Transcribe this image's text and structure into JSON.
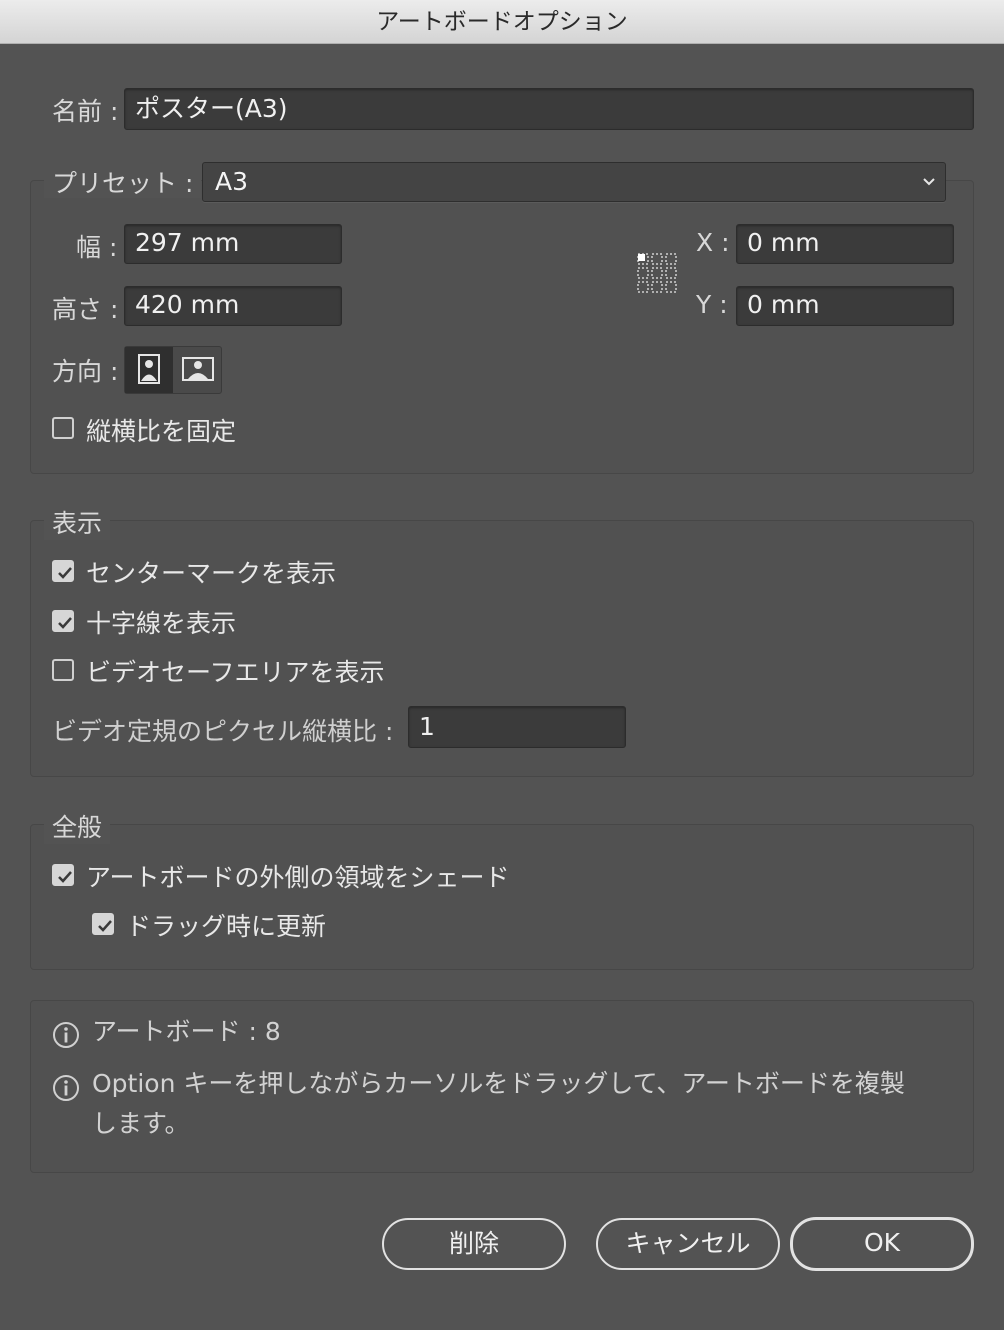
{
  "window": {
    "title": "アートボードオプション"
  },
  "name": {
    "label": "名前 :",
    "value": "ポスター(A3)"
  },
  "preset": {
    "label": "プリセット :",
    "value": "A3"
  },
  "width": {
    "label": "幅 :",
    "value": "297 mm"
  },
  "height": {
    "label": "高さ :",
    "value": "420 mm"
  },
  "x": {
    "label": "X :",
    "value": "0 mm"
  },
  "y": {
    "label": "Y :",
    "value": "0 mm"
  },
  "orientation": {
    "label": "方向 :",
    "options": [
      "portrait",
      "landscape"
    ],
    "selected": "portrait"
  },
  "constrain": {
    "label": "縦横比を固定",
    "checked": false
  },
  "display": {
    "title": "表示",
    "center_mark": {
      "label": "センターマークを表示",
      "checked": true
    },
    "cross_hairs": {
      "label": "十字線を表示",
      "checked": true
    },
    "video_safe": {
      "label": "ビデオセーフエリアを表示",
      "checked": false
    },
    "pixel_aspect": {
      "label": "ビデオ定規のピクセル縦横比 :",
      "value": "1"
    }
  },
  "global": {
    "title": "全般",
    "fade": {
      "label": "アートボードの外側の領域をシェード",
      "checked": true
    },
    "update_drag": {
      "label": "ドラッグ時に更新",
      "checked": true
    }
  },
  "info": {
    "artboards": "アートボード : 8",
    "tip_line1": "Option キーを押しながらカーソルをドラッグして、アートボードを複製",
    "tip_line2": "します。"
  },
  "buttons": {
    "delete": "削除",
    "cancel": "キャンセル",
    "ok": "OK"
  },
  "colors": {
    "background": "#535353",
    "field": "#3b3b3b",
    "titlebar": "#dcdcdc"
  }
}
